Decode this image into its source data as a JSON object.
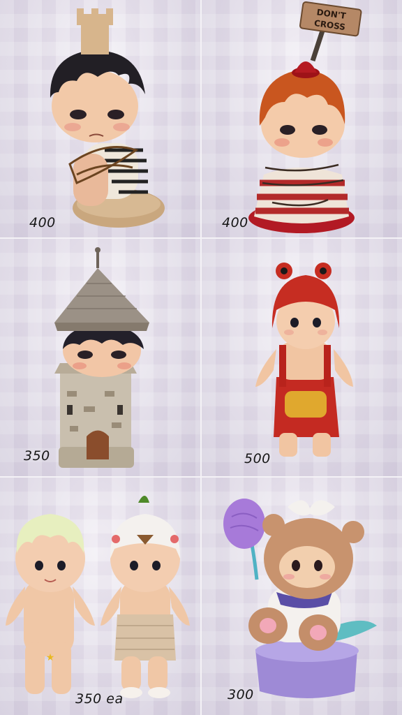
{
  "photo": {
    "prices": {
      "top_left": "400",
      "top_right": "400",
      "middle_left": "350",
      "middle_right": "500",
      "bottom_left": "350 ea",
      "bottom_right": "300"
    },
    "sign_text": [
      "DON'T",
      "CROSS"
    ]
  },
  "colors": {
    "background": "#e3dce9",
    "hair_dark": "#1f1c22",
    "hair_red": "#c4551f",
    "skin": "#f0c6a6",
    "red_suit": "#c42a22"
  }
}
